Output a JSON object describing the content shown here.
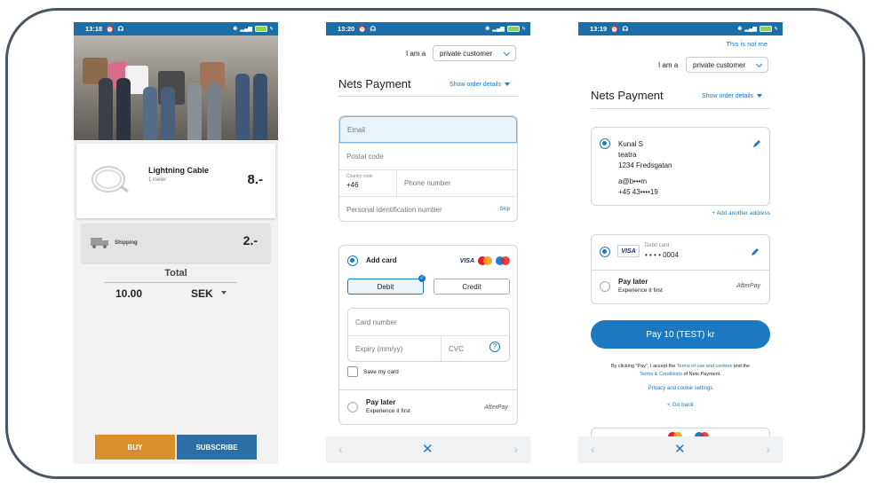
{
  "screen1": {
    "status_time": "13:18",
    "product": {
      "name": "Lightning Cable",
      "sub": "1 meter",
      "price": "8.-"
    },
    "shipping": {
      "label": "Shipping",
      "price": "2.-"
    },
    "total_label": "Total",
    "total_value": "10.00",
    "currency": "SEK",
    "buy_label": "BUY",
    "subscribe_label": "SUBSCRIBE"
  },
  "screen2": {
    "status_time": "13:20",
    "iam_label": "I am a",
    "customer_type": "private customer",
    "title": "Nets Payment",
    "order_details": "Show order details",
    "email_placeholder": "Email",
    "postal_placeholder": "Postal code",
    "country_code_label": "Country code",
    "country_code_value": "+46",
    "phone_placeholder": "Phone number",
    "pin_placeholder": "Personal identification number",
    "skip_label": "Skip",
    "add_card_label": "Add card",
    "visa_text": "VISA",
    "debit_label": "Debit",
    "credit_label": "Credit",
    "card_number_placeholder": "Card number",
    "expiry_placeholder": "Expiry (mm/yy)",
    "cvc_placeholder": "CVC",
    "save_card_label": "Save my card",
    "pay_later_title": "Pay later",
    "pay_later_sub": "Experience it first",
    "afterpay_text": "AfterPay"
  },
  "screen3": {
    "status_time": "13:19",
    "not_me": "This is not me",
    "iam_label": "I am a",
    "customer_type": "private customer",
    "title": "Nets Payment",
    "order_details": "Show order details",
    "address": {
      "name": "Kunal S",
      "line1": "teatra",
      "line2": "1234 Fredsgatan",
      "email": "a@b•••m",
      "phone": "+45 43••••19"
    },
    "add_address": "+ Add another address",
    "card_label": "Debit card",
    "card_number": "• • • • 0004",
    "visa_text": "VISA",
    "pay_later_title": "Pay later",
    "pay_later_sub": "Experience it first",
    "afterpay_text": "AfterPay",
    "pay_button": "Pay 10 (TEST) kr",
    "terms_prefix": "By clicking \"Pay\", I accept the ",
    "terms_link1": "Terms of use and cookies",
    "terms_mid": " and the",
    "terms_link2": "Terms & Conditions",
    "terms_suffix": " of Nets Payment.",
    "privacy_link": "Privacy and cookie settings",
    "go_back": "< Go back"
  },
  "colors": {
    "brand_blue": "#1c78c0",
    "status_blue": "#1b6fa8",
    "buy_orange": "#d98f2b",
    "subscribe_blue": "#2b6fa6"
  }
}
